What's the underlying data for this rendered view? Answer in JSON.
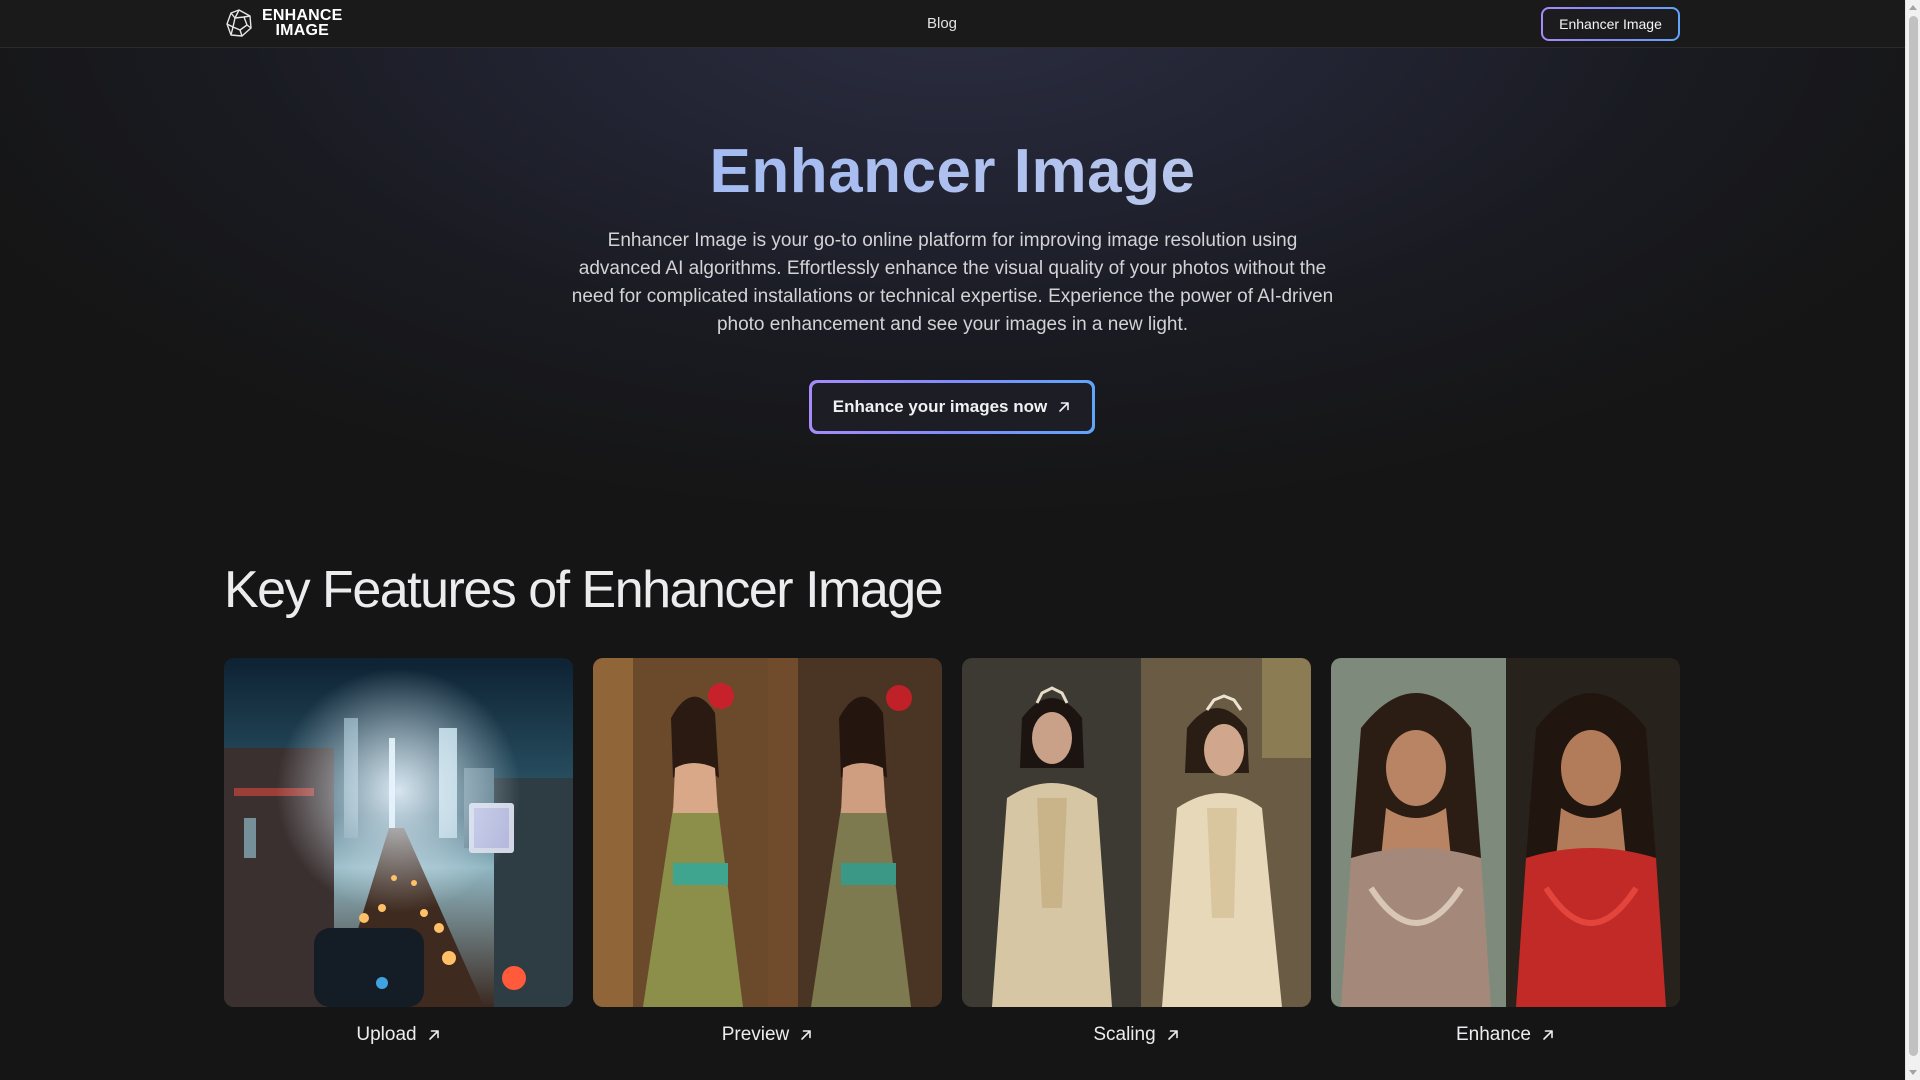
{
  "header": {
    "logo_line1": "ENHANCE",
    "logo_line2": "IMAGE",
    "nav_blog": "Blog",
    "cta_label": "Enhancer Image"
  },
  "hero": {
    "title": "Enhancer Image",
    "description": "Enhancer Image is your go-to online platform for improving image resolution using advanced AI algorithms. Effortlessly enhance the visual quality of your photos without the need for complicated installations or technical expertise. Experience the power of AI-driven photo enhancement and see your images in a new light.",
    "cta_label": "Enhance your images now"
  },
  "features": {
    "title": "Key Features of Enhancer Image",
    "cards": [
      {
        "label": "Upload",
        "image": "night-city-street-photo"
      },
      {
        "label": "Preview",
        "image": "woman-in-dress-before-after-photo"
      },
      {
        "label": "Scaling",
        "image": "woman-with-tiara-before-after-photo"
      },
      {
        "label": "Enhance",
        "image": "woman-portrait-before-after-photo"
      }
    ]
  },
  "colors": {
    "accent_gradient_start": "#a78bfa",
    "accent_gradient_end": "#60a5fa",
    "title_blue": "#8ab4f8",
    "background": "#151515"
  },
  "icons": [
    "logo-icon",
    "arrow-up-right-icon"
  ]
}
